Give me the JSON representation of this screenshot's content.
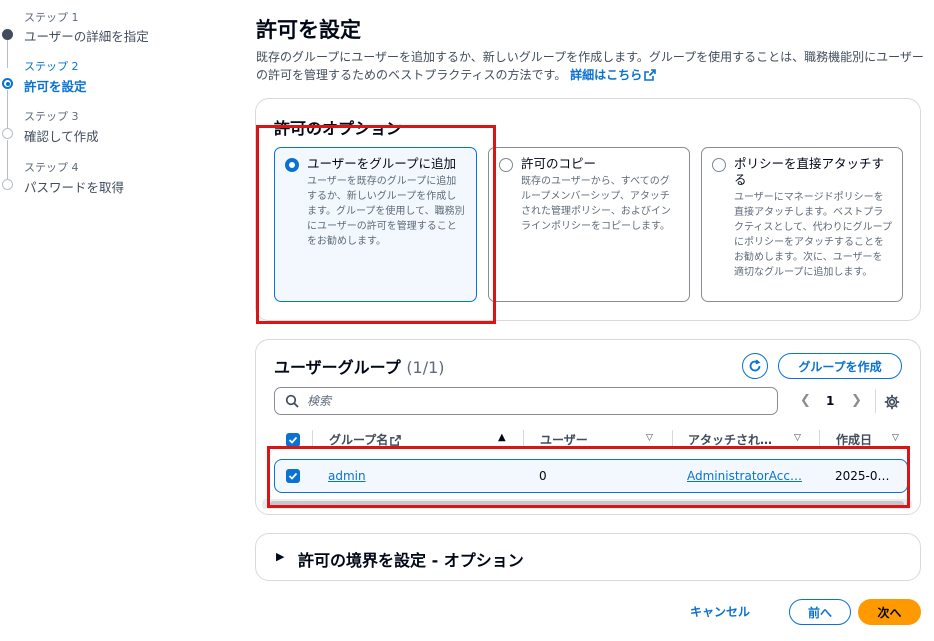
{
  "steps": [
    {
      "num": "ステップ 1",
      "label": "ユーザーの詳細を指定",
      "state": "done"
    },
    {
      "num": "ステップ 2",
      "label": "許可を設定",
      "state": "current"
    },
    {
      "num": "ステップ 3",
      "label": "確認して作成",
      "state": "pending"
    },
    {
      "num": "ステップ 4",
      "label": "パスワードを取得",
      "state": "pending"
    }
  ],
  "page": {
    "title": "許可を設定",
    "description": "既存のグループにユーザーを追加するか、新しいグループを作成します。グループを使用することは、職務機能別にユーザーの許可を管理するためのベストプラクティスの方法です。",
    "learn_more": "詳細はこちら"
  },
  "options": {
    "title": "許可のオプション",
    "tiles": [
      {
        "title": "ユーザーをグループに追加",
        "desc": "ユーザーを既存のグループに追加するか、新しいグループを作成します。グループを使用して、職務別にユーザーの許可を管理することをお勧めします。",
        "selected": true
      },
      {
        "title": "許可のコピー",
        "desc": "既存のユーザーから、すべてのグループメンバーシップ、アタッチされた管理ポリシー、およびインラインポリシーをコピーします。",
        "selected": false
      },
      {
        "title": "ポリシーを直接アタッチする",
        "desc": "ユーザーにマネージドポリシーを直接アタッチします。ベストプラクティスとして、代わりにグループにポリシーをアタッチすることをお勧めします。次に、ユーザーを適切なグループに追加します。",
        "selected": false
      }
    ]
  },
  "groups": {
    "title": "ユーザーグループ",
    "count": "(1/1)",
    "create_label": "グループを作成",
    "search_placeholder": "検索",
    "page_number": "1",
    "columns": [
      "グループ名",
      "ユーザー",
      "アタッチされ…",
      "作成日"
    ],
    "rows": [
      {
        "name": "admin",
        "users": "0",
        "attached": "AdministratorAcc…",
        "created": "2025-0…",
        "checked": true
      }
    ]
  },
  "boundary": {
    "title": "許可の境界を設定 - オプション"
  },
  "footer": {
    "cancel": "キャンセル",
    "prev": "前へ",
    "next": "次へ"
  },
  "colors": {
    "accent": "#0972d3",
    "primary_button": "#ff9900",
    "highlight_box": "#d91515"
  }
}
